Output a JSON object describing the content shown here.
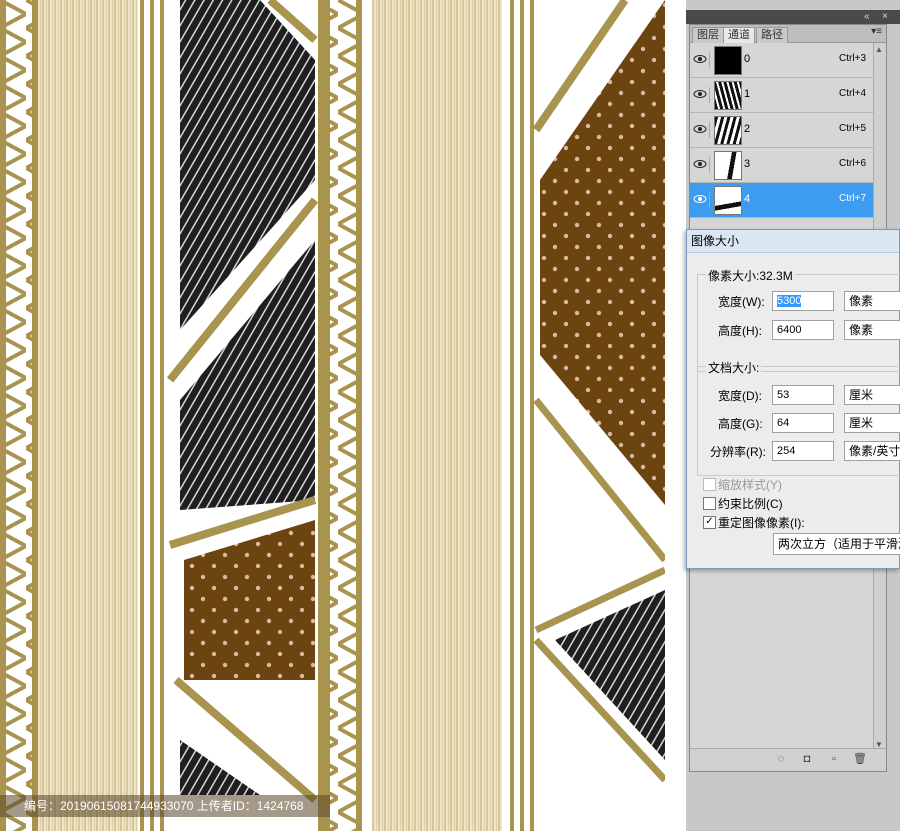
{
  "watermark": {
    "text": "编号：20190615081744933070 上传者ID：1424768"
  },
  "channels_panel": {
    "tabs": [
      {
        "label": "图层",
        "active": false
      },
      {
        "label": "通道",
        "active": true
      },
      {
        "label": "路径",
        "active": false
      }
    ],
    "collapse_icon": "double-chevron-icon",
    "close_icon": "close-icon",
    "menu_icon": "panel-menu-icon",
    "channels": [
      {
        "name": "0",
        "shortcut": "Ctrl+3",
        "selected": false
      },
      {
        "name": "1",
        "shortcut": "Ctrl+4",
        "selected": false
      },
      {
        "name": "2",
        "shortcut": "Ctrl+5",
        "selected": false
      },
      {
        "name": "3",
        "shortcut": "Ctrl+6",
        "selected": false
      },
      {
        "name": "4",
        "shortcut": "Ctrl+7",
        "selected": true
      }
    ],
    "footer_icons": [
      "load-selection-icon",
      "save-selection-icon",
      "new-channel-icon",
      "delete-icon"
    ]
  },
  "image_size_dialog": {
    "title": "图像大小",
    "pixel_dimensions": {
      "title": "像素大小:32.3M",
      "width_label": "宽度(W):",
      "width_value": "5300",
      "width_unit": "像素",
      "height_label": "高度(H):",
      "height_value": "6400",
      "height_unit": "像素"
    },
    "document_size": {
      "title": "文档大小:",
      "width_label": "宽度(D):",
      "width_value": "53",
      "width_unit": "厘米",
      "height_label": "高度(G):",
      "height_value": "64",
      "height_unit": "厘米",
      "resolution_label": "分辨率(R):",
      "resolution_value": "254",
      "resolution_unit": "像素/英寸"
    },
    "options": [
      {
        "label": "缩放样式(Y)",
        "checked": false,
        "disabled": true
      },
      {
        "label": "约束比例(C)",
        "checked": false,
        "disabled": false
      },
      {
        "label": "重定图像像素(I):",
        "checked": true,
        "disabled": false
      }
    ],
    "resample_method": "两次立方（适用于平滑渐"
  },
  "colors": {
    "gold": "#a8944e",
    "cream": "#e9dfc6",
    "brown": "#6b4410",
    "black_stripe": "#1f1f1f",
    "selection": "#3c9cf0"
  }
}
